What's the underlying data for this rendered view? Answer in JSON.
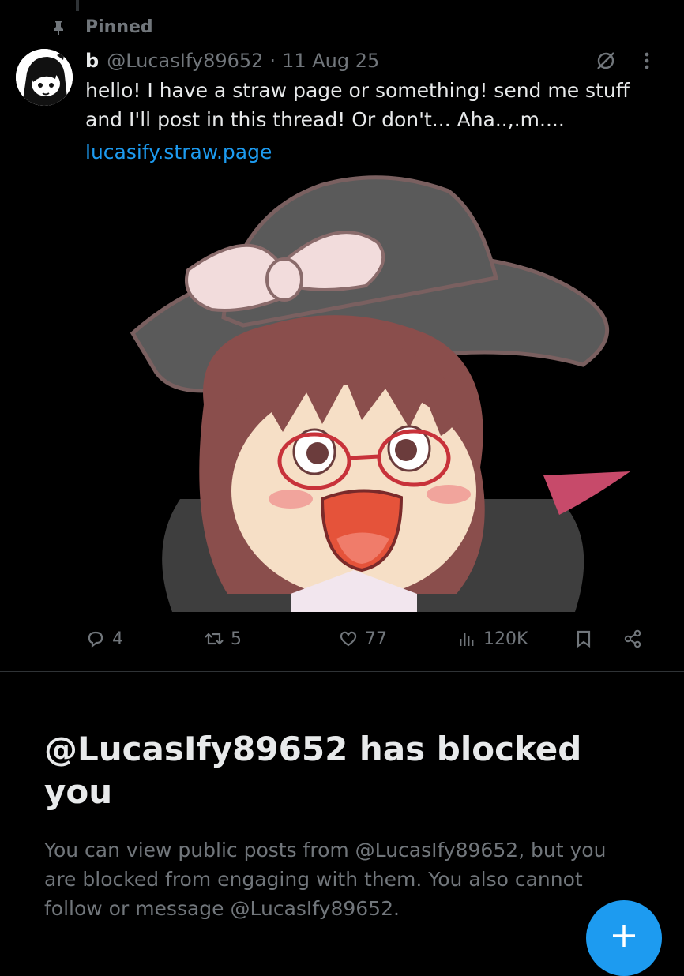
{
  "pinned": {
    "label": "Pinned",
    "icon": "pin-icon"
  },
  "post": {
    "display_name": "b",
    "handle": "@LucasIfy89652",
    "separator": "·",
    "date": "11 Aug 25",
    "text": "hello! I have a straw page or something! send me stuff\nand I'll post in this thread! Or don't... Aha..,.m....",
    "link": "lucasify.straw.page",
    "media_alt": "Chibi anime girl with brown hair, red glasses and a black witch hat with a pink bow"
  },
  "actions": {
    "reply_count": "4",
    "repost_count": "5",
    "like_count": "77",
    "views_count": "120K"
  },
  "blocked": {
    "title": "@LucasIfy89652 has blocked you",
    "description": "You can view public posts from @LucasIfy89652, but you are blocked from engaging with them. You also cannot follow or message @LucasIfy89652."
  },
  "colors": {
    "background": "#000000",
    "text": "#e7e9ea",
    "muted": "#71767b",
    "accent": "#1d9bf0",
    "divider": "#2f3336"
  }
}
